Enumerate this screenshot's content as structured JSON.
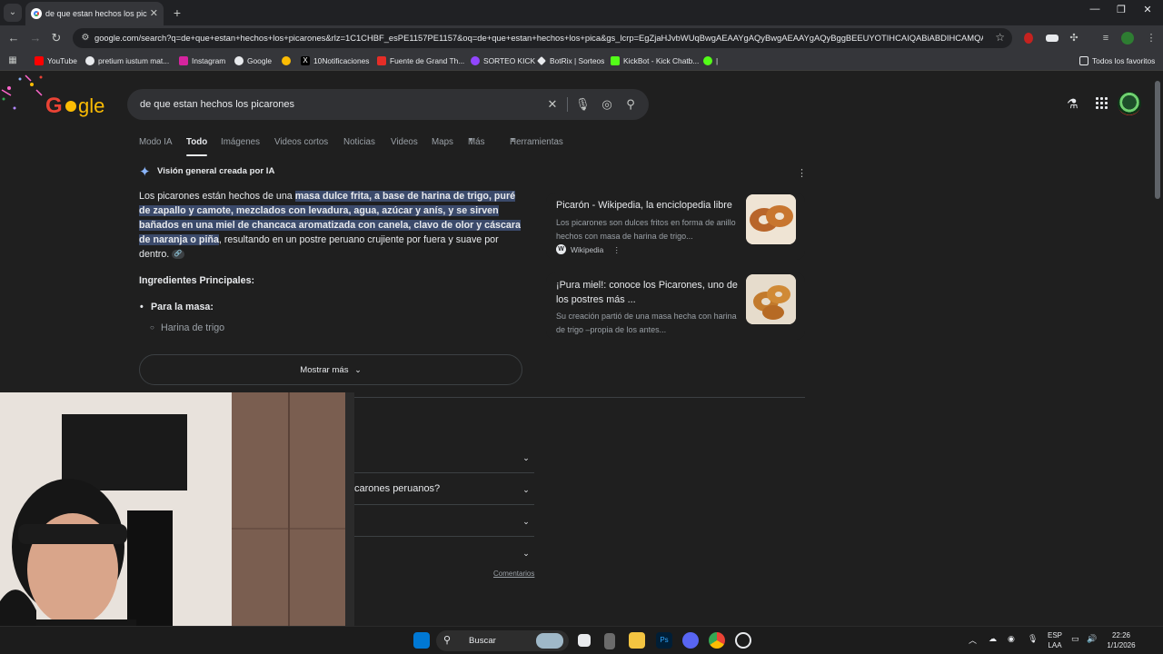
{
  "browser": {
    "tab_title": "de que estan hechos los picarones",
    "url": "google.com/search?q=de+que+estan+hechos+los+picarones&rlz=1C1CHBF_esPE1157PE1157&oq=de+que+estan+hechos+los+pica&gs_lcrp=EgZjaHJvbWUqBwgAEAAYgAQyBwgAEAAYgAQyBggBEEUYOTIHCAIQABiABDIHCAMQABiAB...",
    "bookmarks": [
      {
        "label": "YouTube",
        "color": "#ff0000"
      },
      {
        "label": "pretium iustum mat...",
        "color": "#e8eaed"
      },
      {
        "label": "Instagram",
        "color": "#d6249f"
      },
      {
        "label": "Google",
        "color": "#e8eaed"
      },
      {
        "label": "",
        "color": "#fbbc04"
      },
      {
        "label": "10Notificaciones",
        "color": "#000000"
      },
      {
        "label": "Fuente de Grand Th...",
        "color": "#e52d27"
      },
      {
        "label": "SORTEO KICK",
        "color": "#9146ff"
      },
      {
        "label": "BotRix | Sorteos",
        "color": "#e8eaed"
      },
      {
        "label": "KickBot - Kick Chatb...",
        "color": "#53fc18"
      },
      {
        "label": "|",
        "color": "#53fc18"
      }
    ],
    "bookmarks_other": "Todos los favoritos"
  },
  "search": {
    "query": "de que estan hechos los picarones",
    "tabs": [
      "Modo IA",
      "Todo",
      "Imágenes",
      "Videos cortos",
      "Noticias",
      "Videos",
      "Maps",
      "Más",
      "Herramientas"
    ],
    "active_tab": "Todo"
  },
  "ai_overview": {
    "header": "Visión general creada por IA",
    "text_plain_1": "Los picarones están hechos de una ",
    "text_hl_1": "masa dulce frita, a base de harina de trigo, puré de zapallo y camote, mezclados con levadura, agua, azúcar y anís, y se sirven bañados en una miel de chancaca aromatizada con canela, clavo de olor y cáscara de naranja o piña",
    "text_plain_2": ", resultando en un postre peruano crujiente por fuera y suave por dentro.",
    "ingredients_title": "Ingredientes Principales:",
    "masa_title": "Para la masa:",
    "masa_first": "Harina de trigo",
    "show_more": "Mostrar más"
  },
  "sources": [
    {
      "title": "Picarón - Wikipedia, la enciclopedia libre",
      "snippet": "Los picarones son dulces fritos en forma de anillo hechos con masa de harina de trigo...",
      "site": "Wikipedia"
    },
    {
      "title": "¡Pura miel!: conoce los Picarones, uno de los postres más ...",
      "snippet": "Su creación partió de una masa hecha con harina de trigo –propia de los antes..."
    }
  ],
  "people_also_ask": [
    {
      "question": ""
    },
    {
      "question": "carones peruanos?"
    },
    {
      "question": ""
    },
    {
      "question": ""
    }
  ],
  "feedback": "Comentarios",
  "taskbar": {
    "search": "Buscar",
    "lang_top": "ESP",
    "lang_bottom": "LAA",
    "time": "22:26",
    "date": "1/1/2026"
  }
}
